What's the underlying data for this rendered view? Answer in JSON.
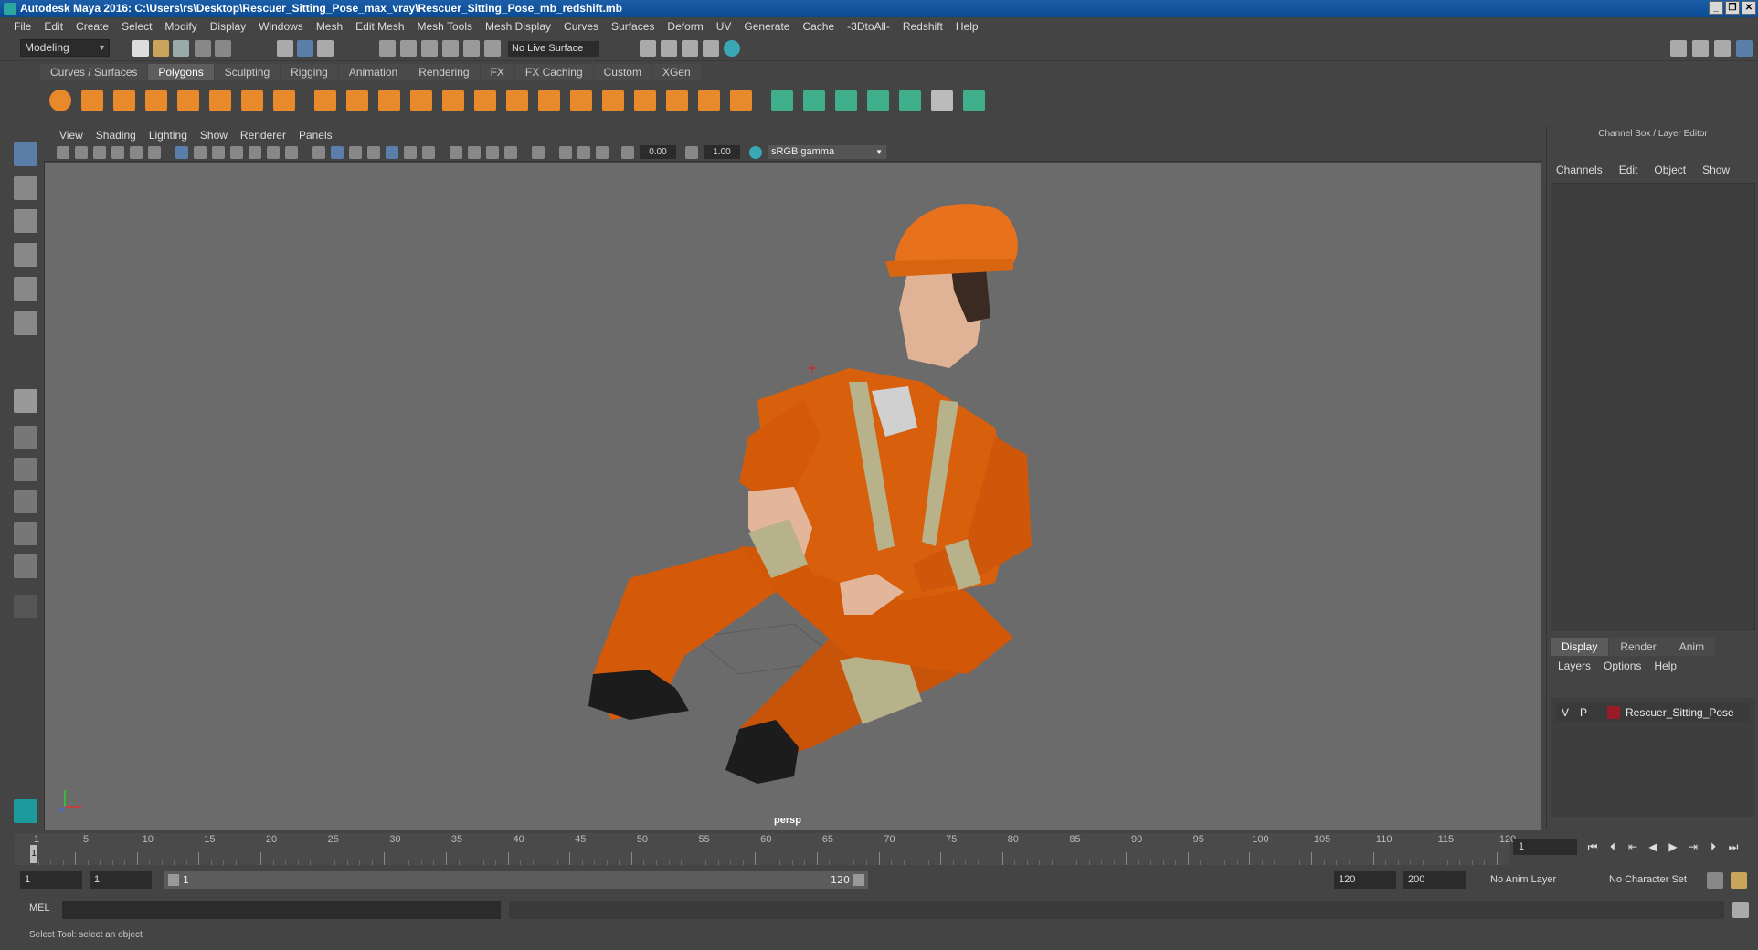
{
  "window": {
    "title": "Autodesk Maya 2016: C:\\Users\\rs\\Desktop\\Rescuer_Sitting_Pose_max_vray\\Rescuer_Sitting_Pose_mb_redshift.mb",
    "controls": [
      "_",
      "❐",
      "✕"
    ]
  },
  "menubar": [
    "File",
    "Edit",
    "Create",
    "Select",
    "Modify",
    "Display",
    "Windows",
    "Mesh",
    "Edit Mesh",
    "Mesh Tools",
    "Mesh Display",
    "Curves",
    "Surfaces",
    "Deform",
    "UV",
    "Generate",
    "Cache",
    "-3DtoAll-",
    "Redshift",
    "Help"
  ],
  "statusline": {
    "mode": "Modeling",
    "live_surface": "No Live Surface"
  },
  "shelf": {
    "tabs": [
      "Curves / Surfaces",
      "Polygons",
      "Sculpting",
      "Rigging",
      "Animation",
      "Rendering",
      "FX",
      "FX Caching",
      "Custom",
      "XGen"
    ],
    "active_tab": "Polygons"
  },
  "viewport": {
    "menu": [
      "View",
      "Shading",
      "Lighting",
      "Show",
      "Renderer",
      "Panels"
    ],
    "exposure": "0.00",
    "gamma": "1.00",
    "color_space": "sRGB gamma",
    "camera": "persp"
  },
  "channel_box": {
    "title": "Channel Box / Layer Editor",
    "menu": [
      "Channels",
      "Edit",
      "Object",
      "Show"
    ]
  },
  "layer_editor": {
    "tabs": [
      "Display",
      "Render",
      "Anim"
    ],
    "active_tab": "Display",
    "menu": [
      "Layers",
      "Options",
      "Help"
    ],
    "layers": [
      {
        "v": "V",
        "p": "P",
        "name": "Rescuer_Sitting_Pose",
        "color": "#9a1b28"
      }
    ]
  },
  "timeline": {
    "ticks": [
      "1",
      "5",
      "10",
      "15",
      "20",
      "25",
      "30",
      "35",
      "40",
      "45",
      "50",
      "55",
      "60",
      "65",
      "70",
      "75",
      "80",
      "85",
      "90",
      "95",
      "100",
      "105",
      "110",
      "115",
      "120"
    ],
    "current_frame": "1"
  },
  "range": {
    "start": "1",
    "playback_start": "1",
    "slider_start": "1",
    "slider_end": "120",
    "playback_end": "120",
    "end": "200",
    "anim_layer": "No Anim Layer",
    "character_set": "No Character Set"
  },
  "command_line": {
    "label": "MEL"
  },
  "help_line": "Select Tool: select an object"
}
